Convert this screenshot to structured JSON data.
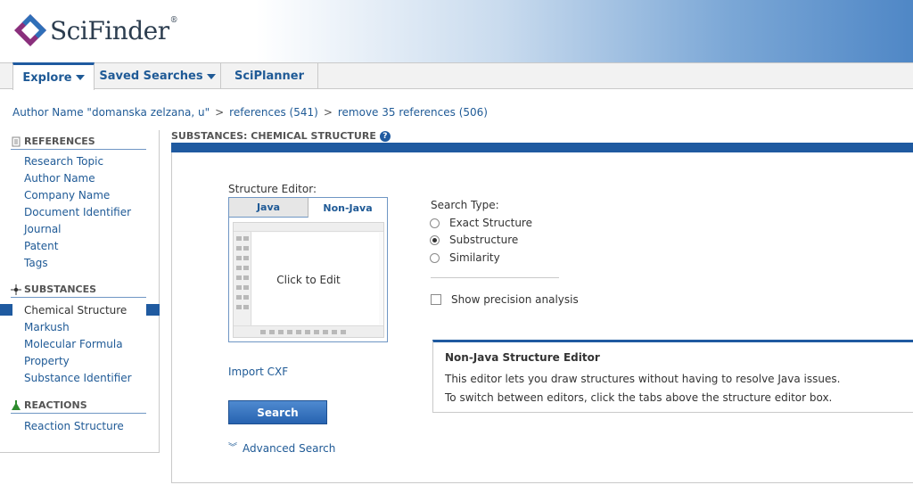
{
  "header": {
    "brand": "SciFinder",
    "brand_mark": "®"
  },
  "nav": {
    "tabs": [
      {
        "label": "Explore",
        "has_menu": true,
        "active": true
      },
      {
        "label": "Saved Searches",
        "has_menu": true,
        "active": false
      },
      {
        "label": "SciPlanner",
        "has_menu": false,
        "active": false
      }
    ]
  },
  "breadcrumb": {
    "items": [
      "Author Name \"domanska zelzana, u\"",
      "references (541)",
      "remove 35 references (506)"
    ],
    "separator": ">"
  },
  "sidebar": {
    "sections": [
      {
        "title": "REFERENCES",
        "icon": "document-icon",
        "items": [
          "Research Topic",
          "Author Name",
          "Company Name",
          "Document Identifier",
          "Journal",
          "Patent",
          "Tags"
        ]
      },
      {
        "title": "SUBSTANCES",
        "icon": "molecule-icon",
        "items": [
          "Chemical Structure",
          "Markush",
          "Molecular Formula",
          "Property",
          "Substance Identifier"
        ]
      },
      {
        "title": "REACTIONS",
        "icon": "flask-icon",
        "items": [
          "Reaction Structure"
        ]
      }
    ],
    "active_item": "Chemical Structure"
  },
  "main": {
    "title": "SUBSTANCES: CHEMICAL STRUCTURE",
    "help_icon": "?",
    "editor": {
      "label": "Structure Editor:",
      "tabs": [
        "Java",
        "Non-Java"
      ],
      "active_tab": "Non-Java",
      "canvas_text": "Click to Edit"
    },
    "import_label": "Import CXF",
    "search_button": "Search",
    "advanced_search": "Advanced Search",
    "search_type": {
      "label": "Search Type:",
      "options": [
        "Exact Structure",
        "Substructure",
        "Similarity"
      ],
      "selected": "Substructure"
    },
    "precision": {
      "label": "Show precision analysis",
      "checked": false
    },
    "info": {
      "title": "Non-Java Structure Editor",
      "line1": "This editor lets you draw structures without having to resolve Java issues.",
      "line2": "To switch between editors, click the tabs above the structure editor box."
    }
  },
  "colors": {
    "accent": "#1f5aa0",
    "link": "#1f5a96",
    "text": "#333333"
  }
}
